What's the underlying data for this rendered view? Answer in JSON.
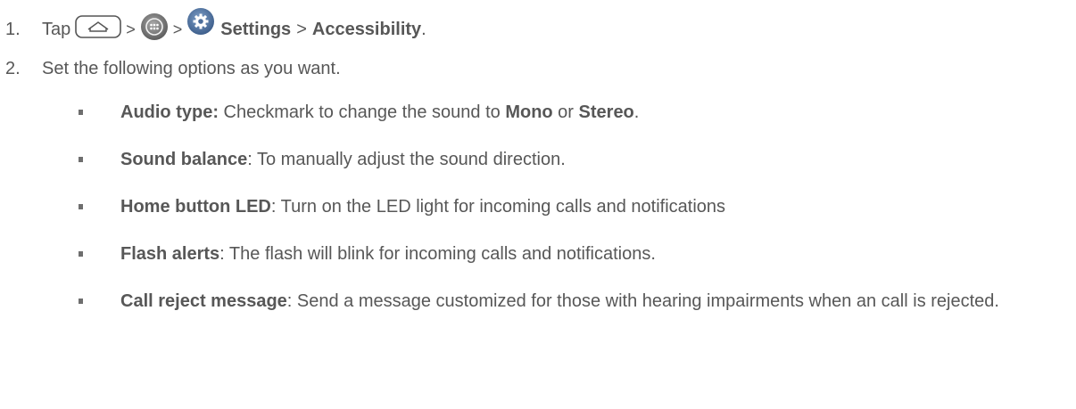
{
  "steps": [
    {
      "number": "1.",
      "prefix": "Tap",
      "sep1": ">",
      "sep2": ">",
      "settings_label": "Settings",
      "sep3": ">",
      "accessibility_label": "Accessibility",
      "end": ".",
      "icons": [
        "home-key-icon",
        "apps-icon",
        "settings-icon"
      ]
    },
    {
      "number": "2.",
      "text": "Set the following options as you want."
    }
  ],
  "options": [
    {
      "name": "Audio type:",
      "desc_before": " Checkmark to change the sound to ",
      "mono": "Mono",
      "or": " or ",
      "stereo": "Stereo",
      "end": "."
    },
    {
      "name": "Sound balance",
      "desc": ": To manually adjust the sound direction."
    },
    {
      "name": "Home button LED",
      "desc": ": Turn on the LED light for incoming calls and notifications"
    },
    {
      "name": "Flash alerts",
      "desc": ": The flash will blink for incoming calls and notifications."
    },
    {
      "name": "Call reject message",
      "desc": ": Send a message customized for those with hearing impairments when an call is rejected."
    }
  ]
}
